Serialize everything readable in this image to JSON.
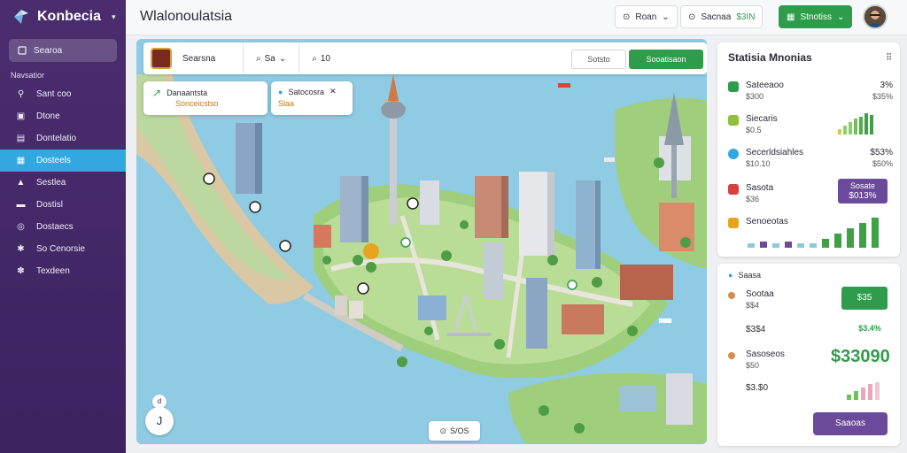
{
  "app": {
    "name": "Konbecia"
  },
  "sidebar": {
    "search_label": "Searoa",
    "section_label": "Navsatior",
    "items": [
      {
        "label": "Sant coo",
        "icon": "pin-icon",
        "active": false
      },
      {
        "label": "Dtone",
        "icon": "folder-icon",
        "active": false
      },
      {
        "label": "Dontelatio",
        "icon": "document-icon",
        "active": false
      },
      {
        "label": "Dosteels",
        "icon": "map-icon",
        "active": true
      },
      {
        "label": "Sestlea",
        "icon": "bookmark-icon",
        "active": false
      },
      {
        "label": "Dostisl",
        "icon": "card-icon",
        "active": false
      },
      {
        "label": "Dostaecs",
        "icon": "globe-icon",
        "active": false
      },
      {
        "label": "So Cenorsie",
        "icon": "gear-icon",
        "active": false
      },
      {
        "label": "Texdeen",
        "icon": "gear-icon",
        "active": false
      }
    ]
  },
  "header": {
    "title": "Wlalonoulatsia",
    "buttons": [
      {
        "label": "Roan"
      },
      {
        "label": "Sacnaa",
        "value": "$3IN"
      },
      {
        "label": "Stnotiss"
      }
    ]
  },
  "map": {
    "toolbar": {
      "label": "Searsna",
      "control1": "Sa",
      "control2": "10",
      "input_placeholder": "Sotsto",
      "action_label": "Sooatisaon"
    },
    "card1": {
      "title": "Danaantsta",
      "subtitle": "Sonceicstso"
    },
    "card2": {
      "title": "Satocosra",
      "subtitle": "Slaa"
    },
    "zoom_label": "J",
    "zoom_mini": "d",
    "status_label": "S/OS"
  },
  "stats": {
    "title": "Statisia Mnonias",
    "metrics": [
      {
        "name": "Sateeaoo",
        "value": "$300",
        "pct": "3%",
        "sub": "$35%",
        "color": "#2f9c4c"
      },
      {
        "name": "Siecaris",
        "value": "$0.5",
        "pct": "",
        "sub": "",
        "color": "#8fbf3d"
      },
      {
        "name": "Secerldsiahles",
        "value": "$10.10",
        "pct": "$53%",
        "sub": "$50%",
        "color": "#33a8e0"
      },
      {
        "name": "Sasota",
        "value": "$36",
        "pct": "",
        "sub": "",
        "color": "#d8413b",
        "badge_line1": "Sosate",
        "badge_line2": "$013%"
      },
      {
        "name": "Senoeotas",
        "value": "",
        "pct": "",
        "sub": "",
        "color": "#e6a41f"
      }
    ]
  },
  "panel2": {
    "head": "Saasa",
    "rows": [
      {
        "name": "Sootaa",
        "value": "$$4",
        "badge": "$35"
      },
      {
        "name": "$3$4",
        "value": "",
        "badge": "$3.4%"
      },
      {
        "name": "Sasoseos",
        "value": "$50",
        "badge": "$33090"
      },
      {
        "name": "$3.$0",
        "value": "",
        "badge": ""
      }
    ],
    "button_label": "Saaoas"
  },
  "colors": {
    "accent": "#33a8e0",
    "sidebar": "#4b2d6e",
    "green": "#2f9c4c",
    "purple": "#6b4a9c"
  }
}
